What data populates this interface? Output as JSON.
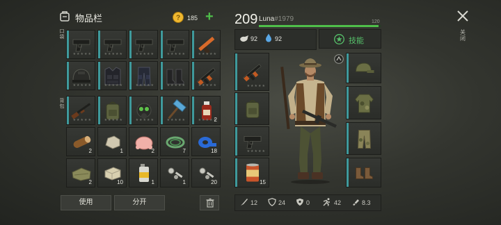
{
  "inventory": {
    "title": "物品栏",
    "coins": "185",
    "add_label": "+",
    "pocket_label": "口袋",
    "backpack_label": "背包",
    "use_button": "使用",
    "split_button": "分开",
    "pocket_items": [
      "pistol-icon",
      "pistol-icon",
      "pistol-icon",
      "pistol-icon",
      "flare-gun-icon",
      "helmet-icon",
      "tactical-vest-icon",
      "cargo-pants-icon",
      "combat-boots-icon",
      "assault-rifle-icon"
    ],
    "backpack_items": [
      {
        "icon": "shotgun-icon",
        "qty": ""
      },
      {
        "icon": "backpack-icon",
        "qty": ""
      },
      {
        "icon": "gas-mask-icon",
        "qty": ""
      },
      {
        "icon": "sledgehammer-icon",
        "qty": ""
      },
      {
        "icon": "medicine-bottle-icon",
        "qty": "2"
      },
      {
        "icon": "log-icon",
        "qty": "2"
      },
      {
        "icon": "stone-icon",
        "qty": "1"
      },
      {
        "icon": "raw-chicken-icon",
        "qty": "2"
      },
      {
        "icon": "rope-icon",
        "qty": "7"
      },
      {
        "icon": "duct-tape-icon",
        "qty": "18"
      },
      {
        "icon": "cloth-icon",
        "qty": "2"
      },
      {
        "icon": "stone-block-icon",
        "qty": "10"
      },
      {
        "icon": "spray-can-icon",
        "qty": "1"
      },
      {
        "icon": "nuts-bolts-icon",
        "qty": "1"
      },
      {
        "icon": "nuts-bolts-icon",
        "qty": "20"
      }
    ]
  },
  "player": {
    "level": "209",
    "name": "Luna",
    "id": "#1979",
    "xp_max": "120",
    "xp_progress": 0.98,
    "food": "92",
    "water": "92",
    "skills_label": "技能",
    "stats": {
      "attack": "12",
      "defense": "24",
      "armor": "0",
      "speed": "42",
      "weight": "8.3"
    },
    "equip_left": [
      {
        "icon": "assault-rifle-icon",
        "qty": ""
      },
      {
        "icon": "backpack-icon",
        "qty": ""
      },
      {
        "icon": "pistol-icon",
        "qty": ""
      },
      {
        "icon": "canned-food-icon",
        "qty": "15"
      }
    ],
    "equip_right": [
      "military-cap-icon",
      "camo-jacket-icon",
      "camo-pants-icon",
      "boots-icon"
    ]
  },
  "close_label": "关闭",
  "colors": {
    "accent": "#3f9a9c",
    "xp": "#4fbf4a",
    "skills": "#56c06a",
    "coin": "#f0b830"
  }
}
